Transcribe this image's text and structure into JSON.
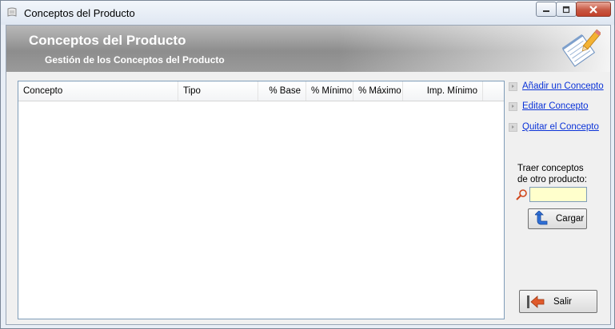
{
  "window": {
    "title": "Conceptos del Producto",
    "controls": [
      "minimize-icon",
      "maximize-icon",
      "close-icon"
    ]
  },
  "banner": {
    "title": "Conceptos del Producto",
    "subtitle": "Gestión de los Conceptos del Producto",
    "icon": "notepad-pencil-icon"
  },
  "grid": {
    "columns": [
      "Concepto",
      "Tipo",
      "% Base",
      "% Mínimo",
      "% Máximo",
      "Imp. Mínimo"
    ],
    "rows": []
  },
  "actions": {
    "add": "Añadir un Concepto",
    "edit": "Editar Concepto",
    "remove": "Quitar el Concepto"
  },
  "import": {
    "label_line1": "Traer conceptos",
    "label_line2": "de otro producto:",
    "value": "",
    "button": "Cargar"
  },
  "footer": {
    "exit_button": "Salir"
  },
  "colors": {
    "link": "#0b33d8",
    "input_background": "#ffffcc",
    "banner_gray": "#9a9a9a"
  }
}
